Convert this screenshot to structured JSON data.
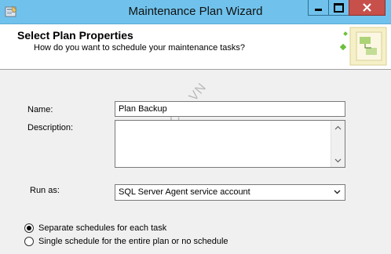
{
  "window": {
    "title": "Maintenance Plan Wizard"
  },
  "header": {
    "title": "Select Plan Properties",
    "subtitle": "How do you want to schedule your maintenance tasks?"
  },
  "form": {
    "name_label": "Name:",
    "name_value": "Plan Backup",
    "description_label": "Description:",
    "description_value": "",
    "run_as_label": "Run as:",
    "run_as_value": "SQL Server Agent service account"
  },
  "schedule": {
    "options": [
      {
        "label": "Separate schedules for each task",
        "checked": true
      },
      {
        "label": "Single schedule for the entire plan or no schedule",
        "checked": false
      }
    ]
  },
  "watermark": "CTL.VN",
  "colors": {
    "titlebar": "#70c2ec",
    "close_button": "#c7504b",
    "background": "#f0f0f0"
  }
}
